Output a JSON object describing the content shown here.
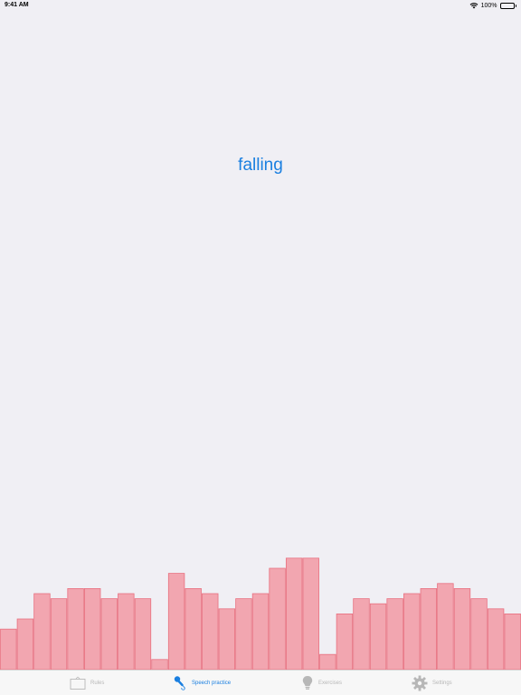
{
  "status_bar": {
    "time": "9:41 AM",
    "battery_percent": "100%",
    "battery_level": 1.0
  },
  "main": {
    "word": "falling",
    "word_color": "#1a7fe0"
  },
  "level_bars": {
    "fill_color": "#f2a6b0",
    "stroke_color": "#e8707f",
    "levels": [
      0.32,
      0.4,
      0.6,
      0.56,
      0.64,
      0.64,
      0.56,
      0.6,
      0.56,
      0.08,
      0.76,
      0.64,
      0.6,
      0.48,
      0.56,
      0.6,
      0.8,
      0.88,
      0.88,
      0.12,
      0.44,
      0.56,
      0.52,
      0.56,
      0.6,
      0.64,
      0.68,
      0.64,
      0.56,
      0.48,
      0.44
    ]
  },
  "tab_bar": {
    "active_color": "#1a7fe0",
    "inactive_color": "#b7b7b7",
    "tabs": [
      {
        "label": "Rules",
        "icon": "board-icon",
        "active": false
      },
      {
        "label": "Speech practice",
        "icon": "microphone-icon",
        "active": true
      },
      {
        "label": "Exercises",
        "icon": "lightbulb-icon",
        "active": false
      },
      {
        "label": "Settings",
        "icon": "gear-icon",
        "active": false
      }
    ]
  }
}
